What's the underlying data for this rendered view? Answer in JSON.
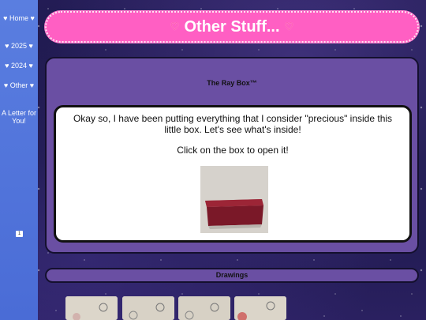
{
  "sidebar": {
    "items": [
      {
        "label": "♥ Home ♥"
      },
      {
        "label": "♥ 2025 ♥"
      },
      {
        "label": "♥ 2024 ♥"
      },
      {
        "label": "♥ Other ♥"
      },
      {
        "label": "A Letter for You!"
      }
    ],
    "badge": "1"
  },
  "header": {
    "title": "Other Stuff...",
    "heart_left": "♡",
    "heart_right": "♡"
  },
  "ray_box": {
    "title": "The Ray Box™",
    "text": "Okay so, I have been putting everything that I consider \"precious\" inside this little box. Let's see what's inside!",
    "cta": "Click on the box to open it!"
  },
  "drawings": {
    "title": "Drawings"
  },
  "colors": {
    "header_pink": "#ff5fc3",
    "panel_purple": "#6a4fa3",
    "sidebar_blue": "#5a7ee0"
  }
}
